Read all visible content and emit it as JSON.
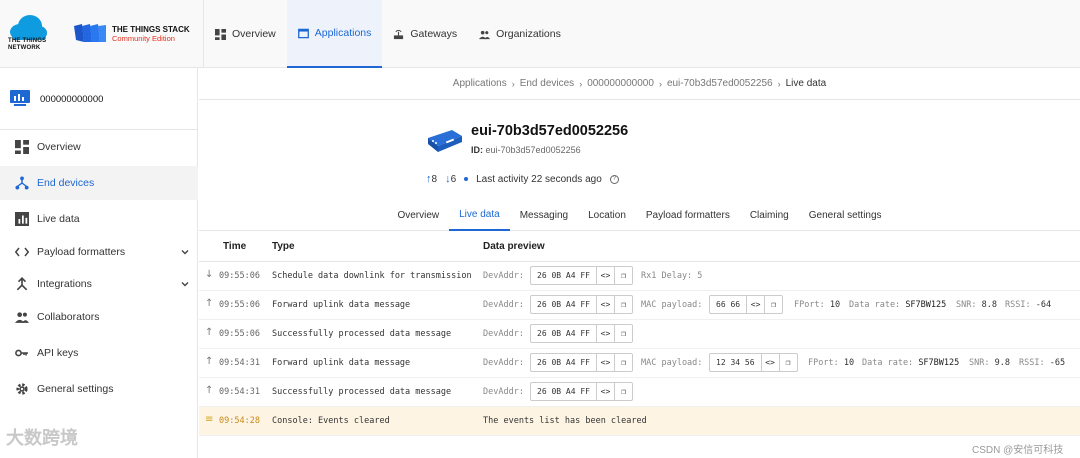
{
  "brand": {
    "ttn_line1": "THE THINGS",
    "ttn_line2": "NETWORK",
    "stack_title": "THE THINGS STACK",
    "stack_edition": "Community Edition"
  },
  "topnav": [
    {
      "label": "Overview",
      "icon": "grid-icon",
      "active": false
    },
    {
      "label": "Applications",
      "icon": "window-icon",
      "active": true
    },
    {
      "label": "Gateways",
      "icon": "gateway-icon",
      "active": false
    },
    {
      "label": "Organizations",
      "icon": "people-icon",
      "active": false
    }
  ],
  "sidebar": {
    "app_name": "000000000000",
    "items": [
      {
        "label": "Overview",
        "icon": "grid-icon",
        "active": false
      },
      {
        "label": "End devices",
        "icon": "network-icon",
        "active": true
      },
      {
        "label": "Live data",
        "icon": "chart-icon",
        "active": false
      },
      {
        "label": "Payload formatters",
        "icon": "code-icon",
        "active": false,
        "expandable": true
      },
      {
        "label": "Integrations",
        "icon": "integration-icon",
        "active": false,
        "expandable": true
      },
      {
        "label": "Collaborators",
        "icon": "people-icon",
        "active": false
      },
      {
        "label": "API keys",
        "icon": "key-icon",
        "active": false
      },
      {
        "label": "General settings",
        "icon": "gear-icon",
        "active": false
      }
    ]
  },
  "breadcrumb": [
    "Applications",
    "End devices",
    "000000000000",
    "eui-70b3d57ed0052256",
    "Live data"
  ],
  "device": {
    "title": "eui-70b3d57ed0052256",
    "id_label": "ID:",
    "id_value": "eui-70b3d57ed0052256",
    "up_count": "8",
    "down_count": "6",
    "last_activity": "Last activity 22 seconds ago"
  },
  "tabs": [
    {
      "label": "Overview",
      "active": false
    },
    {
      "label": "Live data",
      "active": true
    },
    {
      "label": "Messaging",
      "active": false
    },
    {
      "label": "Location",
      "active": false
    },
    {
      "label": "Payload formatters",
      "active": false
    },
    {
      "label": "Claiming",
      "active": false
    },
    {
      "label": "General settings",
      "active": false
    }
  ],
  "table": {
    "headers": {
      "time": "Time",
      "type": "Type",
      "preview": "Data preview"
    },
    "rows": [
      {
        "dir": "down",
        "time": "09:55:06",
        "type": "Schedule data downlink for transmission",
        "devaddr_label": "DevAddr:",
        "devaddr": "26 0B A4 FF",
        "extra": "Rx1 Delay: 5"
      },
      {
        "dir": "up",
        "time": "09:55:06",
        "type": "Forward uplink data message",
        "devaddr_label": "DevAddr:",
        "devaddr": "26 0B A4 FF",
        "mac_label": "MAC payload:",
        "mac": "66 66",
        "fport_label": "FPort:",
        "fport": "10",
        "rate_label": "Data rate:",
        "rate": "SF7BW125",
        "snr_label": "SNR:",
        "snr": "8.8",
        "rssi_label": "RSSI:",
        "rssi": "-64"
      },
      {
        "dir": "up",
        "time": "09:55:06",
        "type": "Successfully processed data message",
        "devaddr_label": "DevAddr:",
        "devaddr": "26 0B A4 FF"
      },
      {
        "dir": "up",
        "time": "09:54:31",
        "type": "Forward uplink data message",
        "devaddr_label": "DevAddr:",
        "devaddr": "26 0B A4 FF",
        "mac_label": "MAC payload:",
        "mac": "12 34 56",
        "fport_label": "FPort:",
        "fport": "10",
        "rate_label": "Data rate:",
        "rate": "SF7BW125",
        "snr_label": "SNR:",
        "snr": "9.8",
        "rssi_label": "RSSI:",
        "rssi": "-65"
      },
      {
        "dir": "up",
        "time": "09:54:31",
        "type": "Successfully processed data message",
        "devaddr_label": "DevAddr:",
        "devaddr": "26 0B A4 FF"
      },
      {
        "dir": "console",
        "time": "09:54:28",
        "type": "Console: Events cleared",
        "message": "The events list has been cleared"
      }
    ]
  },
  "watermarks": {
    "left": "大数跨境",
    "right": "CSDN @安信可科技"
  },
  "colors": {
    "accent": "#1d68d3",
    "console_bg": "#fdf4e4",
    "stack_red": "#e0301e"
  }
}
